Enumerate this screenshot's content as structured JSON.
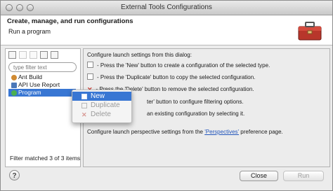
{
  "window": {
    "title": "External Tools Configurations"
  },
  "header": {
    "title": "Create, manage, and run configurations",
    "subtitle": "Run a program",
    "icon": "toolbox-icon"
  },
  "left_panel": {
    "filter_placeholder": "type filter text",
    "tree": [
      {
        "label": "Ant Build",
        "icon": "ant-icon"
      },
      {
        "label": "API Use Report",
        "icon": "report-icon"
      },
      {
        "label": "Program",
        "icon": "program-icon",
        "selected": true
      }
    ],
    "status": "Filter matched 3 of 3 items"
  },
  "context_menu": {
    "items": [
      {
        "label": "New",
        "icon": "new-doc-icon",
        "state": "active"
      },
      {
        "label": "Duplicate",
        "icon": "duplicate-icon",
        "state": "disabled"
      },
      {
        "label": "Delete",
        "icon": "delete-icon",
        "state": "disabled"
      }
    ]
  },
  "right_panel": {
    "intro": "Configure launch settings from this dialog:",
    "line_new": "- Press the 'New' button to create a configuration of the selected type.",
    "line_dup": "- Press the 'Duplicate' button to copy the selected configuration.",
    "line_del": "- Press the 'Delete' button to remove the selected configuration.",
    "line_filter_partial": "ter' button to configure filtering options.",
    "line_edit_partial": "an existing configuration by selecting it.",
    "persp_prefix": "Configure launch perspective settings from the ",
    "persp_link": "'Perspectives'",
    "persp_suffix": " preference page."
  },
  "buttons": {
    "help": "?",
    "close": "Close",
    "run": "Run"
  },
  "colors": {
    "selection": "#3876d3",
    "link": "#2255bb",
    "delete_red": "#c8372d"
  }
}
